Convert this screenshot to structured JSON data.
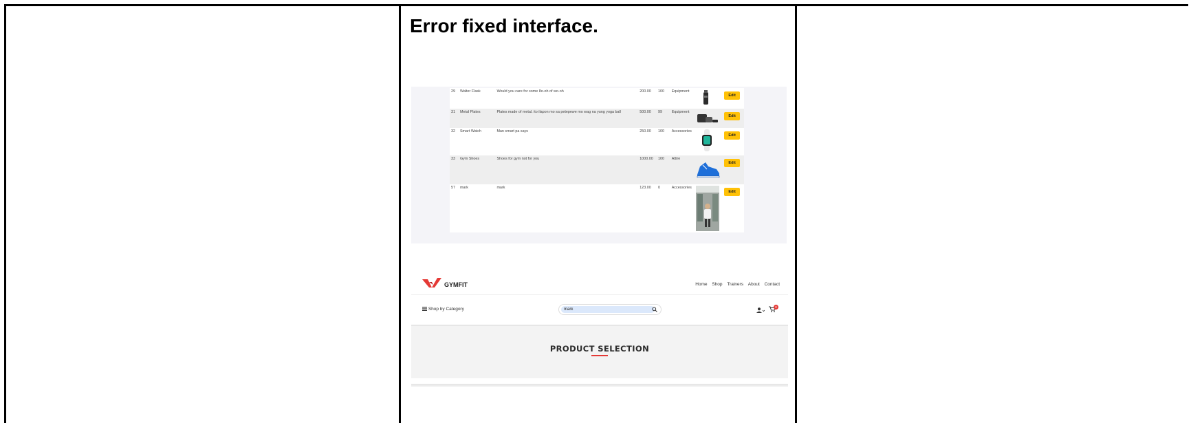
{
  "doc": {
    "title": "Error fixed interface."
  },
  "products": [
    {
      "id": "29",
      "name": "Walter Flask",
      "description": "Would you care for some 8o-oh of wo-oh",
      "price": "200.00",
      "stock": "100",
      "category": "Equipment",
      "image_icon": "water-bottle-icon",
      "action": "Edit"
    },
    {
      "id": "31",
      "name": "Metal Plates",
      "description": "Plates made of metal. ito ilapon mo sa petepewe mo wag na yung yoga ball",
      "price": "500.00",
      "stock": "99",
      "category": "Equipment",
      "image_icon": "weight-plates-icon",
      "action": "Edit"
    },
    {
      "id": "32",
      "name": "Smart Watch",
      "description": "Man smart pa says",
      "price": "250.00",
      "stock": "100",
      "category": "Accessories",
      "image_icon": "smart-watch-icon",
      "action": "Edit"
    },
    {
      "id": "33",
      "name": "Gym Shoes",
      "description": "Shoes for gym not for you",
      "price": "1000.00",
      "stock": "100",
      "category": "Attire",
      "image_icon": "sneaker-icon",
      "action": "Edit"
    },
    {
      "id": "57",
      "name": "mark",
      "description": "mark",
      "price": "123.00",
      "stock": "0",
      "category": "Accessories",
      "image_icon": "person-photo-icon",
      "action": "Edit"
    }
  ],
  "site": {
    "brand": "GYMFIT",
    "nav": [
      "Home",
      "Shop",
      "Trainers",
      "About",
      "Contact"
    ],
    "category_menu": "Shop by Category",
    "search_value": "mark",
    "cart_count": "0",
    "hero_title": "PRODUCT SELECTION",
    "colors": {
      "accent": "#e53935",
      "edit_button": "#ffc107",
      "search_fill": "#dbe8fb"
    }
  }
}
